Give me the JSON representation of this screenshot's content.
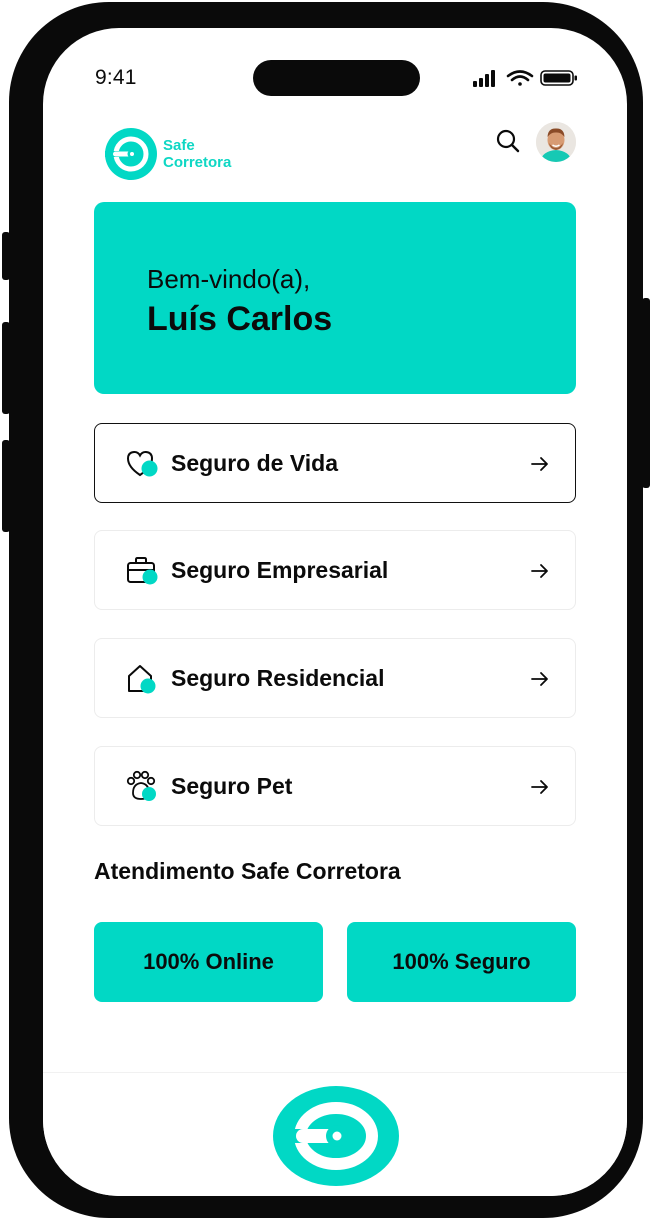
{
  "status_bar": {
    "time": "9:41"
  },
  "brand": {
    "name_line1": "Safe",
    "name_line2": "Corretora",
    "accent_color": "#01d8c5"
  },
  "header": {
    "search_icon": "search-icon",
    "avatar": "user-avatar"
  },
  "welcome": {
    "greeting": "Bem-vindo(a),",
    "user_name": "Luís Carlos"
  },
  "insurance_items": [
    {
      "label": "Seguro de Vida",
      "icon": "heart-icon",
      "selected": true
    },
    {
      "label": "Seguro Empresarial",
      "icon": "briefcase-icon",
      "selected": false
    },
    {
      "label": "Seguro Residencial",
      "icon": "house-icon",
      "selected": false
    },
    {
      "label": "Seguro Pet",
      "icon": "paw-icon",
      "selected": false
    }
  ],
  "support": {
    "title": "Atendimento Safe Corretora",
    "buttons": [
      {
        "label": "100% Online"
      },
      {
        "label": "100% Seguro"
      }
    ]
  }
}
